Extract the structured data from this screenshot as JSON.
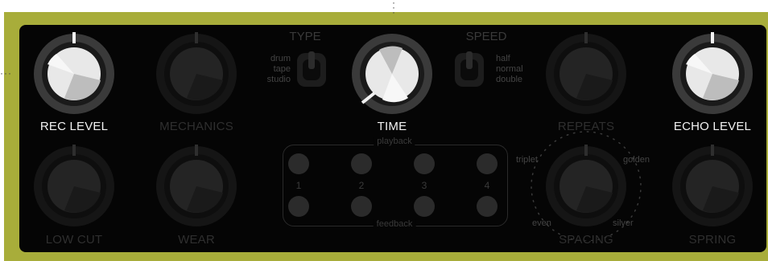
{
  "knobs": {
    "rec_level": {
      "label": "REC LEVEL",
      "active": true
    },
    "mechanics": {
      "label": "MECHANICS",
      "active": false
    },
    "time": {
      "label": "TIME",
      "active": true
    },
    "repeats": {
      "label": "REPEATS",
      "active": false
    },
    "echo_level": {
      "label": "ECHO LEVEL",
      "active": true
    },
    "low_cut": {
      "label": "LOW CUT",
      "active": false
    },
    "wear": {
      "label": "WEAR",
      "active": false
    },
    "spacing": {
      "label": "SPACING",
      "active": false
    },
    "spring": {
      "label": "SPRING",
      "active": false
    }
  },
  "type_switch": {
    "title": "TYPE",
    "options": [
      "drum",
      "tape",
      "studio"
    ]
  },
  "speed_switch": {
    "title": "SPEED",
    "options": [
      "half",
      "normal",
      "double"
    ]
  },
  "heads": {
    "top_label": "playback",
    "bottom_label": "feedback",
    "numbers": [
      "1",
      "2",
      "3",
      "4"
    ]
  },
  "spacing_options": {
    "left_top": "triplet",
    "right_top": "golden",
    "left_bottom": "even",
    "right_bottom": "silver"
  },
  "colors": {
    "panel": "#050505",
    "frame": "#a8ad3a",
    "active_text": "#f2f2f2",
    "inactive_text": "#2f2f2f"
  }
}
